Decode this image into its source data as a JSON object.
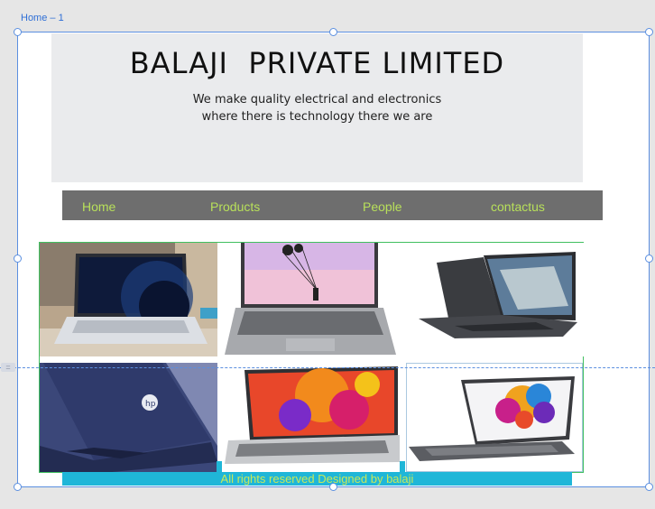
{
  "artboard": {
    "label": "Home – 1"
  },
  "header": {
    "title": "BALAJI  PRIVATE LIMITED",
    "tagline_line1": "We make quality electrical and electronics",
    "tagline_line2": "where there is technology there we are"
  },
  "nav": {
    "items": [
      {
        "label": "Home"
      },
      {
        "label": "Products"
      },
      {
        "label": "People"
      },
      {
        "label": "contactus"
      }
    ]
  },
  "gallery": {
    "images": [
      "laptop-silver-desk",
      "laptop-grey-pink-screen",
      "laptop-dark-side",
      "laptop-blue-back",
      "laptop-silver-color-splash",
      "laptop-slim-color-splash"
    ]
  },
  "footer": {
    "text": "All rights reserved Designed by balaji"
  },
  "colors": {
    "nav_bg": "#6e6e6e",
    "nav_text": "#b8e05a",
    "footer_bg": "#1fb6d8",
    "selection": "#5b8fe0"
  }
}
